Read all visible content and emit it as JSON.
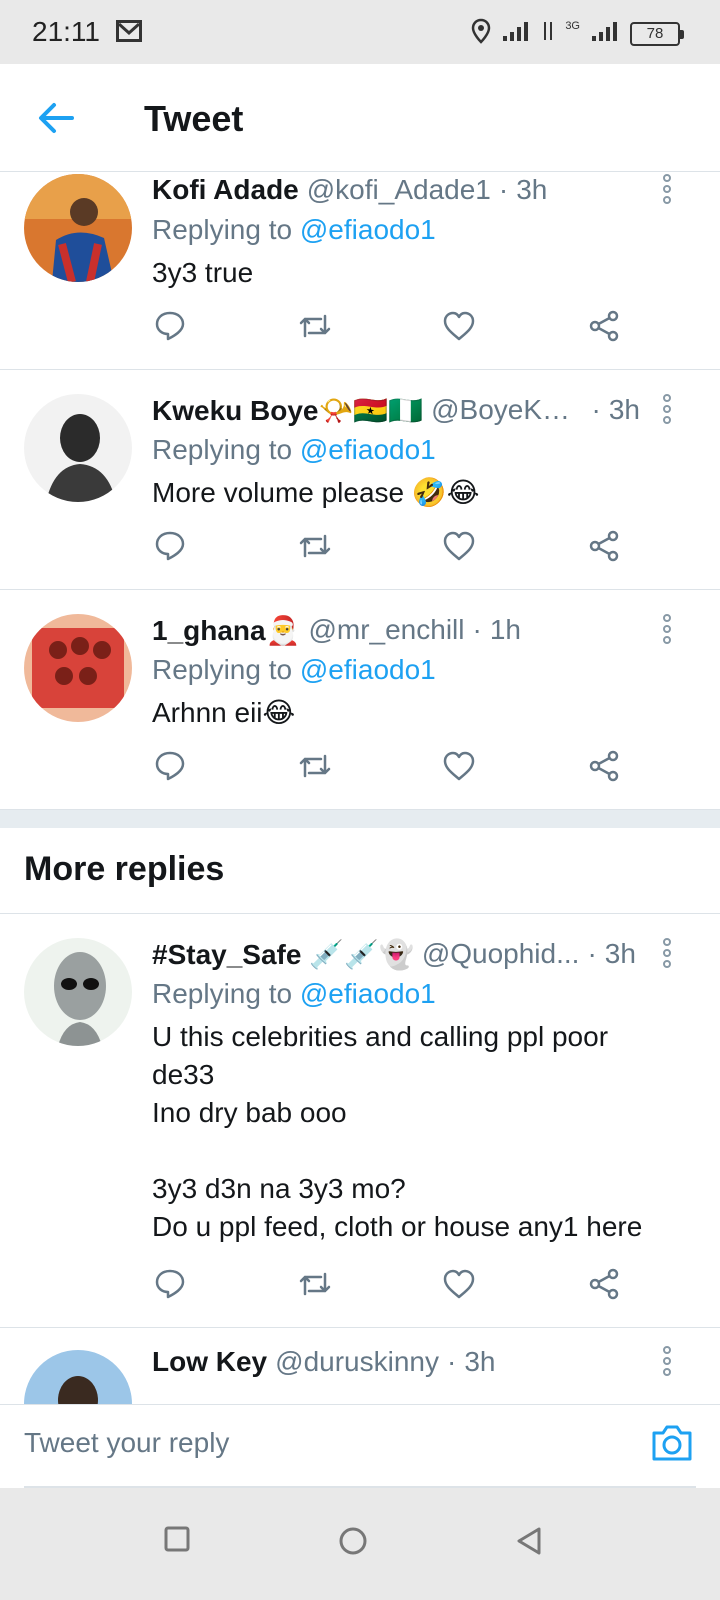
{
  "status_bar": {
    "time": "21:11",
    "network": "3G",
    "battery": "78"
  },
  "header": {
    "title": "Tweet"
  },
  "tweets": [
    {
      "name": "Kofi Adade",
      "handle": "@kofi_Adade1",
      "age": "3h",
      "replying_prefix": "Replying to",
      "replying_to": "@efiaodo1",
      "text": "3y3 true"
    },
    {
      "name": "Kweku Boye📯🇬🇭🇳🇬",
      "handle": "@BoyeKw...",
      "age": "3h",
      "replying_prefix": "Replying to",
      "replying_to": "@efiaodo1",
      "text": "More volume please 🤣😂"
    },
    {
      "name": "1_ghana🎅",
      "handle": "@mr_enchill",
      "age": "1h",
      "replying_prefix": "Replying to",
      "replying_to": "@efiaodo1",
      "text": "Arhnn eii😂"
    }
  ],
  "more_replies": {
    "label": "More replies",
    "tweets": [
      {
        "name": "#Stay_Safe 💉💉👻",
        "handle": "@Quophid...",
        "age": "3h",
        "replying_prefix": "Replying to",
        "replying_to": "@efiaodo1",
        "text_lines": [
          "U this celebrities and calling ppl poor",
          "de33",
          "Ino dry bab ooo",
          "",
          "3y3 d3n na 3y3 mo?",
          "Do u ppl feed, cloth or house any1 here"
        ]
      },
      {
        "name": "Low Key",
        "handle": "@duruskinny",
        "age": "3h"
      }
    ]
  },
  "composer": {
    "placeholder": "Tweet your reply"
  },
  "colors": {
    "accent": "#1da1f2",
    "secondary_text": "#657786",
    "divider": "#dde3e8"
  }
}
